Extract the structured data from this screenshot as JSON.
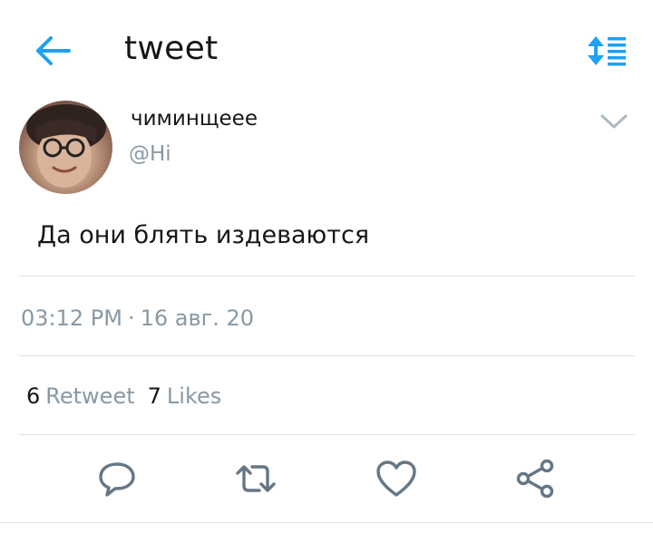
{
  "header": {
    "title": "tweet",
    "back_icon": "arrow-left-icon",
    "sort_icon": "sort-list-icon",
    "accent_color": "#1da1f2"
  },
  "tweet": {
    "author_name": "чиминщеее",
    "author_handle": "@Hi",
    "text": "Да они блять издеваются",
    "time": "03:12 PM",
    "separator": "·",
    "date": "16 авг. 20",
    "retweet_count": "6",
    "retweet_label": "Retweet",
    "like_count": "7",
    "like_label": "Likes"
  },
  "actions": [
    {
      "name": "reply",
      "icon": "comment-icon"
    },
    {
      "name": "retweet",
      "icon": "retweet-icon"
    },
    {
      "name": "like",
      "icon": "heart-icon"
    },
    {
      "name": "share",
      "icon": "share-icon"
    }
  ],
  "colors": {
    "text_primary": "#14171a",
    "text_secondary": "#8899a6",
    "divider": "#dfe3e7",
    "icon_gray": "#657786"
  }
}
